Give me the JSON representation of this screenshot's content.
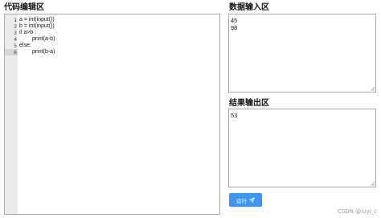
{
  "panels": {
    "code_title": "代码编辑区",
    "input_title": "数据输入区",
    "output_title": "结果输出区"
  },
  "editor": {
    "line_numbers": [
      "1",
      "2",
      "3",
      "4",
      "5",
      "6"
    ],
    "active_line": 6,
    "lines": [
      "a = int(input())",
      "b = int(input())",
      "if a>b :",
      "print(a-b)",
      "else:",
      "print(b-a)"
    ]
  },
  "input": {
    "lines": [
      "45",
      "98"
    ]
  },
  "output": {
    "lines": [
      "53"
    ]
  },
  "run_button": {
    "label": "运行",
    "icon": "send-icon",
    "color": "#3d96f0"
  },
  "watermark": "CSDN @luyi_c"
}
